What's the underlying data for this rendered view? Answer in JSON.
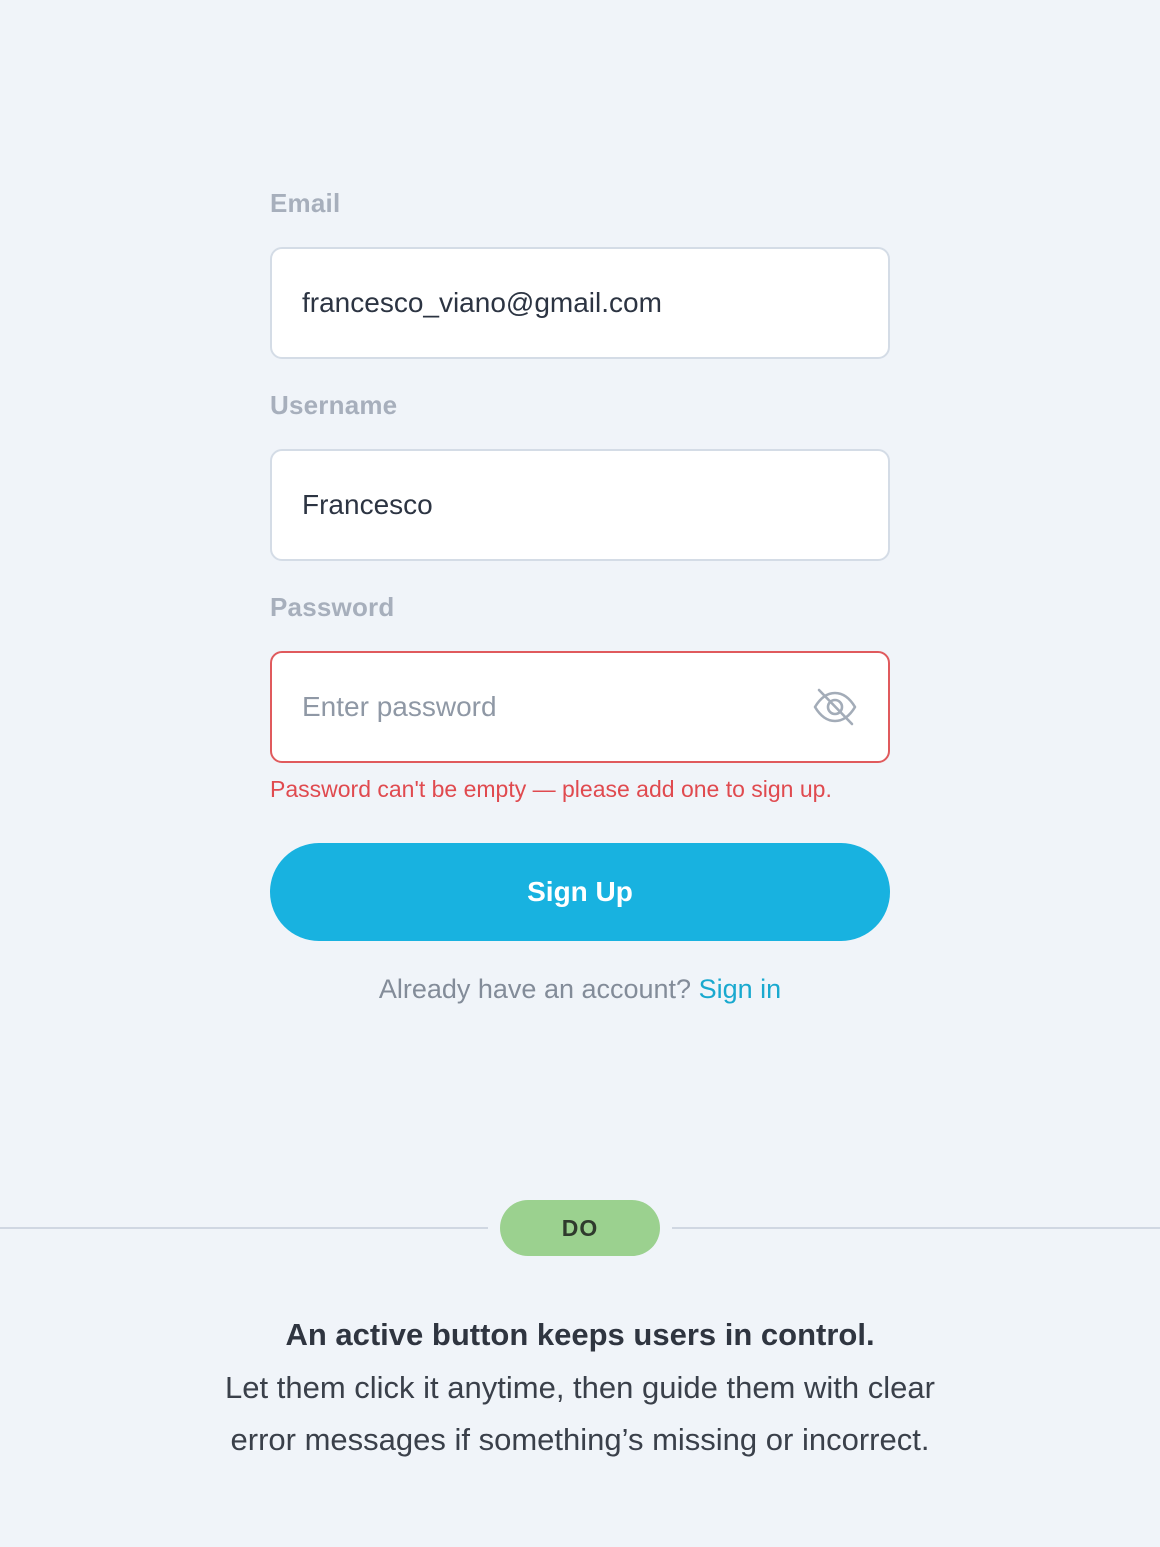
{
  "form": {
    "email": {
      "label": "Email",
      "value": "francesco_viano@gmail.com"
    },
    "username": {
      "label": "Username",
      "value": "Francesco"
    },
    "password": {
      "label": "Password",
      "placeholder": "Enter password",
      "icon": "eye-off-icon",
      "error": "Password can't be empty — please add one to sign up."
    },
    "submit_label": "Sign Up",
    "signin_prompt": "Already have an account?",
    "signin_link": "Sign in"
  },
  "badge": {
    "label": "DO",
    "color": "#9bd18f"
  },
  "caption": {
    "title": "An active button keeps users in control.",
    "body_line1": "Let them click it anytime, then guide them with clear",
    "body_line2": "error messages if something’s missing or incorrect."
  },
  "colors": {
    "accent": "#18b2e0",
    "error": "#e04a4f",
    "link": "#19a9cf",
    "background": "#f0f4f9"
  }
}
